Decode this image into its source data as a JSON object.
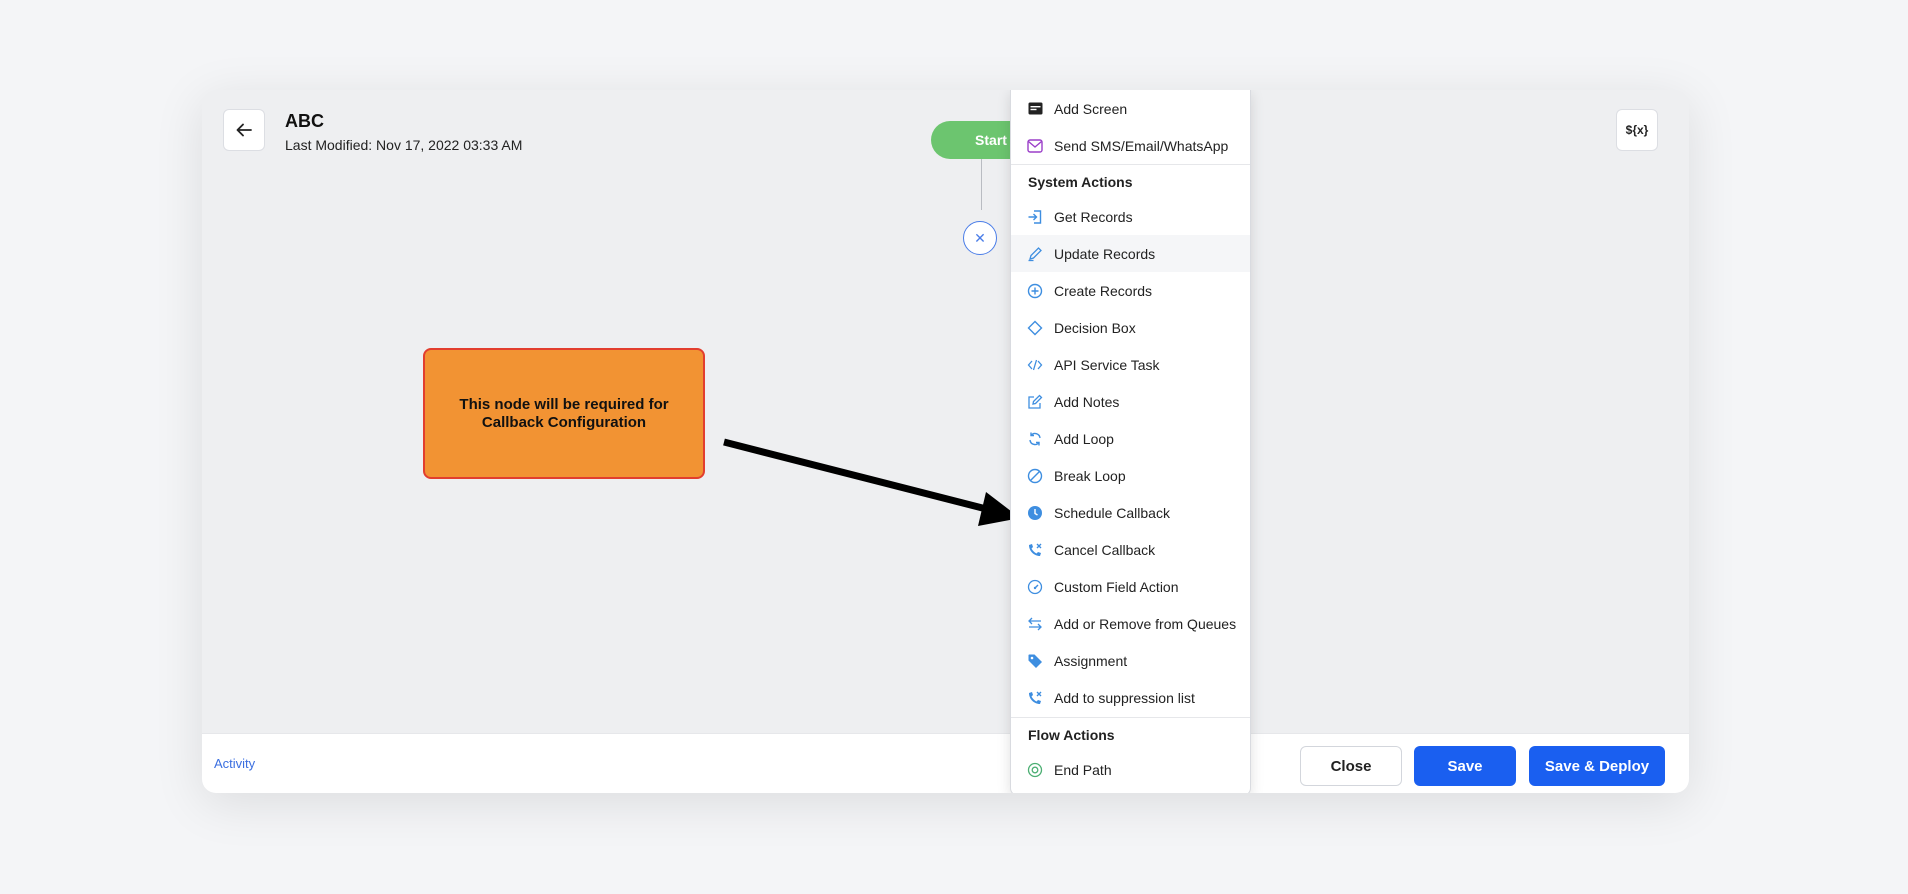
{
  "header": {
    "title": "ABC",
    "last_modified": "Last Modified: Nov 17, 2022 03:33 AM",
    "variables_label": "${x}"
  },
  "canvas": {
    "start_label": "Start",
    "close_node_label": "✕",
    "callout_text": "This node will be required for Callback Configuration"
  },
  "menu": {
    "top_items": [
      {
        "label": "Add Screen",
        "icon": "screen-icon"
      },
      {
        "label": "Send SMS/Email/WhatsApp",
        "icon": "message-icon"
      }
    ],
    "system_actions_title": "System Actions",
    "system_actions": [
      {
        "label": "Get Records",
        "icon": "login-icon"
      },
      {
        "label": "Update Records",
        "icon": "pencil-icon"
      },
      {
        "label": "Create Records",
        "icon": "plus-circle-icon"
      },
      {
        "label": "Decision Box",
        "icon": "diamond-icon"
      },
      {
        "label": "API Service Task",
        "icon": "code-icon"
      },
      {
        "label": "Add Notes",
        "icon": "note-icon"
      },
      {
        "label": "Add Loop",
        "icon": "loop-icon"
      },
      {
        "label": "Break Loop",
        "icon": "ban-icon"
      },
      {
        "label": "Schedule Callback",
        "icon": "clock-icon"
      },
      {
        "label": "Cancel Callback",
        "icon": "phone-cancel-icon"
      },
      {
        "label": "Custom Field Action",
        "icon": "gauge-icon"
      },
      {
        "label": "Add or Remove from Queues",
        "icon": "swap-icon"
      },
      {
        "label": "Assignment",
        "icon": "tag-icon"
      },
      {
        "label": "Add to suppression list",
        "icon": "phone-cancel-icon"
      }
    ],
    "flow_actions_title": "Flow Actions",
    "flow_actions": [
      {
        "label": "End Path",
        "icon": "end-circle-icon"
      }
    ]
  },
  "footer": {
    "activity_label": "Activity",
    "close_label": "Close",
    "save_label": "Save",
    "save_deploy_label": "Save & Deploy"
  },
  "colors": {
    "primary": "#1a5ff0",
    "start_green": "#6cc56f",
    "callout_orange": "#f29333",
    "callout_border": "#e23e2e",
    "icon_blue": "#3e8ee0"
  }
}
